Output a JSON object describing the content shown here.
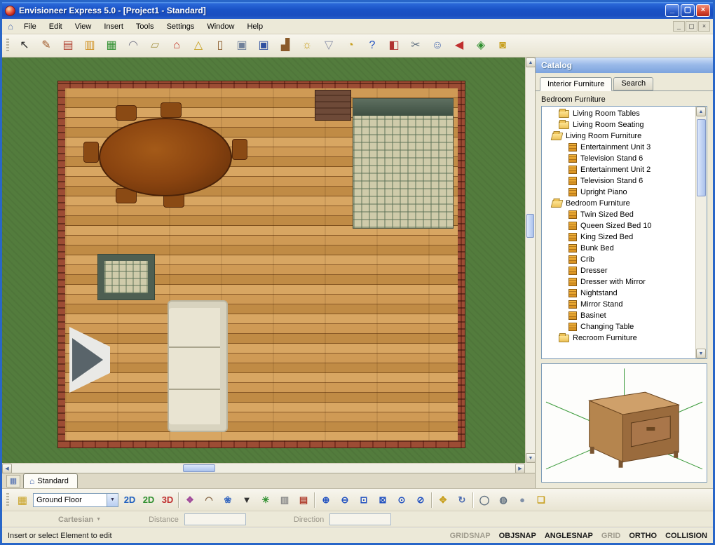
{
  "window": {
    "title": "Envisioneer Express 5.0 - [Project1 - Standard]",
    "controls": {
      "minimize": "_",
      "maximize": "▢",
      "close": "×"
    },
    "mdi_controls": {
      "minimize": "_",
      "restore": "▢",
      "close": "×"
    }
  },
  "menu": {
    "items": [
      "File",
      "Edit",
      "View",
      "Insert",
      "Tools",
      "Settings",
      "Window",
      "Help"
    ]
  },
  "toolbar": {
    "buttons": [
      {
        "name": "select-tool-icon",
        "glyph": "↖",
        "color": "#2a2a2a"
      },
      {
        "name": "paintbrush-tool-icon",
        "glyph": "✎",
        "color": "#a05a2a"
      },
      {
        "name": "wall-tool-icon",
        "glyph": "▤",
        "color": "#b04030"
      },
      {
        "name": "cabinet-tool-icon",
        "glyph": "▥",
        "color": "#d09020"
      },
      {
        "name": "window-tool-icon",
        "glyph": "▦",
        "color": "#2f8f2f"
      },
      {
        "name": "roof-tool-icon",
        "glyph": "◠",
        "color": "#7a7a8a"
      },
      {
        "name": "floor-tool-icon",
        "glyph": "▱",
        "color": "#a8964a"
      },
      {
        "name": "house-tool-icon",
        "glyph": "⌂",
        "color": "#c03020"
      },
      {
        "name": "terrain-tool-icon",
        "glyph": "△",
        "color": "#c8a020"
      },
      {
        "name": "door-tool-icon",
        "glyph": "▯",
        "color": "#8a5a2a"
      },
      {
        "name": "camera-view-icon",
        "glyph": "▣",
        "color": "#70809a"
      },
      {
        "name": "monitor-icon",
        "glyph": "▣",
        "color": "#3050a0"
      },
      {
        "name": "furniture-tool-icon",
        "glyph": "▟",
        "color": "#8a5a2a"
      },
      {
        "name": "lamp-tool-icon",
        "glyph": "☼",
        "color": "#c8a020"
      },
      {
        "name": "fixture-tool-icon",
        "glyph": "▽",
        "color": "#8a90a8"
      },
      {
        "name": "clock-tool-icon",
        "glyph": "◔",
        "color": "#c8a020"
      },
      {
        "name": "help-icon",
        "glyph": "?",
        "color": "#2050c0"
      },
      {
        "name": "toolbox-icon",
        "glyph": "◧",
        "color": "#b03030"
      },
      {
        "name": "cutter-tool-icon",
        "glyph": "✂",
        "color": "#607080"
      },
      {
        "name": "assistant-help-icon",
        "glyph": "☺",
        "color": "#4a6ab0"
      },
      {
        "name": "back-arrow-icon",
        "glyph": "◀",
        "color": "#c03030"
      },
      {
        "name": "view-3d-home-icon",
        "glyph": "◈",
        "color": "#2f8f2f"
      },
      {
        "name": "lock-icon",
        "glyph": "◙",
        "color": "#c8a020"
      }
    ]
  },
  "canvas": {
    "view_tab": {
      "label": "Standard"
    }
  },
  "catalog": {
    "title": "Catalog",
    "tabs": [
      {
        "label": "Interior Furniture",
        "state": "active"
      },
      {
        "label": "Search",
        "state": "inactive"
      }
    ],
    "category_label": "Bedroom Furniture",
    "tree": [
      {
        "label": "Living Room Tables",
        "icon": "folder",
        "indent": "i0",
        "icon_name": "folder-icon"
      },
      {
        "label": "Living Room Seating",
        "icon": "folder",
        "indent": "i0",
        "icon_name": "folder-icon"
      },
      {
        "label": "Living Room Furniture",
        "icon": "folder-open",
        "indent": "i0o",
        "icon_name": "open-folder-icon"
      },
      {
        "label": "Entertainment Unit 3",
        "icon": "item",
        "indent": "i1",
        "icon_name": "furniture-item-icon"
      },
      {
        "label": "Television Stand 6",
        "icon": "item",
        "indent": "i1",
        "icon_name": "furniture-item-icon"
      },
      {
        "label": "Entertainment Unit 2",
        "icon": "item",
        "indent": "i1",
        "icon_name": "furniture-item-icon"
      },
      {
        "label": "Television Stand 6",
        "icon": "item",
        "indent": "i1",
        "icon_name": "furniture-item-icon"
      },
      {
        "label": "Upright Piano",
        "icon": "item",
        "indent": "i1",
        "icon_name": "furniture-item-icon"
      },
      {
        "label": "Bedroom Furniture",
        "icon": "folder-open",
        "indent": "i0o",
        "icon_name": "open-folder-icon"
      },
      {
        "label": "Twin Sized Bed",
        "icon": "item",
        "indent": "i1",
        "icon_name": "furniture-item-icon"
      },
      {
        "label": "Queen Sized Bed 10",
        "icon": "item",
        "indent": "i1",
        "icon_name": "furniture-item-icon"
      },
      {
        "label": "King Sized Bed",
        "icon": "item",
        "indent": "i1",
        "icon_name": "furniture-item-icon"
      },
      {
        "label": "Bunk Bed",
        "icon": "item",
        "indent": "i1",
        "icon_name": "furniture-item-icon"
      },
      {
        "label": "Crib",
        "icon": "item",
        "indent": "i1",
        "icon_name": "furniture-item-icon"
      },
      {
        "label": "Dresser",
        "icon": "item",
        "indent": "i1",
        "icon_name": "furniture-item-icon"
      },
      {
        "label": "Dresser with Mirror",
        "icon": "item",
        "indent": "i1",
        "icon_name": "furniture-item-icon"
      },
      {
        "label": "Nightstand",
        "icon": "item",
        "indent": "i1",
        "icon_name": "furniture-item-icon"
      },
      {
        "label": "Mirror Stand",
        "icon": "item",
        "indent": "i1",
        "icon_name": "furniture-item-icon"
      },
      {
        "label": "Basinet",
        "icon": "item",
        "indent": "i1",
        "icon_name": "furniture-item-icon"
      },
      {
        "label": "Changing Table",
        "icon": "item",
        "indent": "i1",
        "icon_name": "furniture-item-icon"
      },
      {
        "label": "Recroom Furniture",
        "icon": "folder",
        "indent": "i0",
        "icon_name": "folder-icon"
      }
    ]
  },
  "bottom_toolbar": {
    "floor_select": {
      "value": "Ground Floor"
    },
    "buttons": [
      {
        "type": "btn",
        "name": "view-2d-plan-icon",
        "glyph": "2D",
        "color": "#1f5fbf"
      },
      {
        "type": "btn",
        "name": "view-2d-grid-icon",
        "glyph": "2D",
        "color": "#2f8f2f"
      },
      {
        "type": "btn",
        "name": "view-3d-icon",
        "glyph": "3D",
        "color": "#c03030"
      },
      {
        "type": "sep",
        "name": "toolbar-separator",
        "glyph": "",
        "color": ""
      },
      {
        "type": "btn",
        "name": "components-icon",
        "glyph": "❖",
        "color": "#a04a9a"
      },
      {
        "type": "btn",
        "name": "arch-tool-icon",
        "glyph": "◠",
        "color": "#8a6a4a"
      },
      {
        "type": "btn",
        "name": "plant-tool-icon",
        "glyph": "❀",
        "color": "#3a6ac0"
      },
      {
        "type": "btn",
        "name": "filter-funnel-icon",
        "glyph": "▼",
        "color": "#333333"
      },
      {
        "type": "btn",
        "name": "sprinkler-tool-icon",
        "glyph": "✳",
        "color": "#2f8f2f"
      },
      {
        "type": "btn",
        "name": "fence-tool-icon",
        "glyph": "▥",
        "color": "#8a8a8a"
      },
      {
        "type": "btn",
        "name": "brick-material-icon",
        "glyph": "▤",
        "color": "#b04030"
      },
      {
        "type": "sep",
        "name": "toolbar-separator",
        "glyph": "",
        "color": ""
      },
      {
        "type": "btn",
        "name": "zoom-in-icon",
        "glyph": "⊕",
        "color": "#2050c0"
      },
      {
        "type": "btn",
        "name": "zoom-out-icon",
        "glyph": "⊖",
        "color": "#2050c0"
      },
      {
        "type": "btn",
        "name": "zoom-window-icon",
        "glyph": "⊡",
        "color": "#2050c0"
      },
      {
        "type": "btn",
        "name": "zoom-extents-icon",
        "glyph": "⊠",
        "color": "#2050c0"
      },
      {
        "type": "btn",
        "name": "zoom-selected-icon",
        "glyph": "⊙",
        "color": "#2050c0"
      },
      {
        "type": "btn",
        "name": "zoom-dynamic-icon",
        "glyph": "⊘",
        "color": "#2050c0"
      },
      {
        "type": "sep",
        "name": "toolbar-separator",
        "glyph": "",
        "color": ""
      },
      {
        "type": "btn",
        "name": "pan-hand-icon",
        "glyph": "✥",
        "color": "#c8a020"
      },
      {
        "type": "btn",
        "name": "orbit-icon",
        "glyph": "↻",
        "color": "#4a6ab0"
      },
      {
        "type": "sep",
        "name": "toolbar-separator",
        "glyph": "",
        "color": ""
      },
      {
        "type": "btn",
        "name": "wireframe-mode-icon",
        "glyph": "◯",
        "color": "#607080"
      },
      {
        "type": "btn",
        "name": "hidden-line-mode-icon",
        "glyph": "◍",
        "color": "#607080"
      },
      {
        "type": "btn",
        "name": "shaded-mode-icon",
        "glyph": "●",
        "color": "#8090a8"
      },
      {
        "type": "btn",
        "name": "layers-icon",
        "glyph": "❏",
        "color": "#c8a020"
      }
    ]
  },
  "coord_bar": {
    "mode_label": "Cartesian",
    "distance_label": "Distance",
    "distance_value": "",
    "direction_label": "Direction",
    "direction_value": ""
  },
  "status_bar": {
    "message": "Insert or select Element to edit",
    "toggles": [
      {
        "label": "GRIDSNAP",
        "state": "off"
      },
      {
        "label": "OBJSNAP",
        "state": "on"
      },
      {
        "label": "ANGLESNAP",
        "state": "on"
      },
      {
        "label": "GRID",
        "state": "off"
      },
      {
        "label": "ORTHO",
        "state": "on"
      },
      {
        "label": "COLLISION",
        "state": "on"
      }
    ]
  }
}
